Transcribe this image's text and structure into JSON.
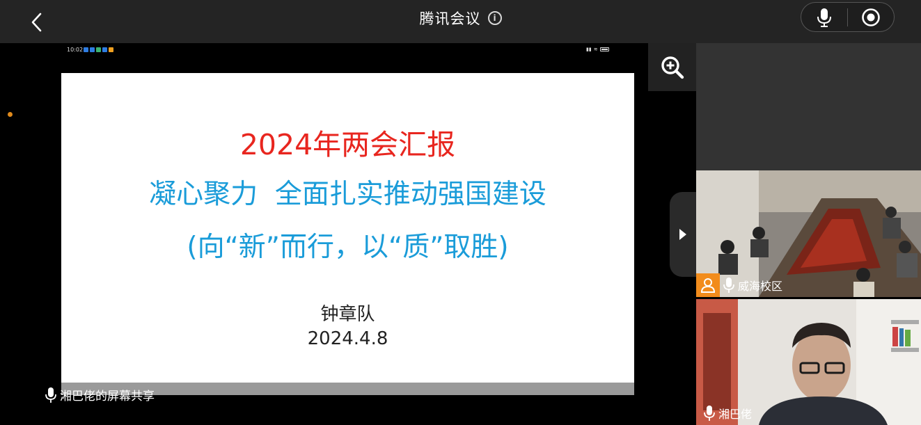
{
  "header": {
    "title": "腾讯会议"
  },
  "device_status": {
    "time": "10:02",
    "app_icon_colors": [
      "#2f7de1",
      "#2f7de1",
      "#3cb371",
      "#2f7de1",
      "#f0a020"
    ]
  },
  "slide": {
    "title": "2024年两会汇报",
    "subtitle": "凝心聚力  全面扎实推动强国建设",
    "subtitle2": "(向“新”而行，以“质”取胜)",
    "author": "钟章队",
    "date": "2024.4.8"
  },
  "share_label": "湘巴佬的屏幕共享",
  "participants": [
    {
      "name": "威海校区"
    },
    {
      "name": "湘巴佬"
    }
  ],
  "colors": {
    "slide_title": "#e8261f",
    "slide_subtitle": "#1a9cd9",
    "avatar": "#f28c1c",
    "topbar": "#242424"
  },
  "icons": [
    "back-icon",
    "info-icon",
    "microphone-icon",
    "record-icon",
    "zoom-in-icon",
    "chevron-right-icon",
    "avatar-icon"
  ]
}
